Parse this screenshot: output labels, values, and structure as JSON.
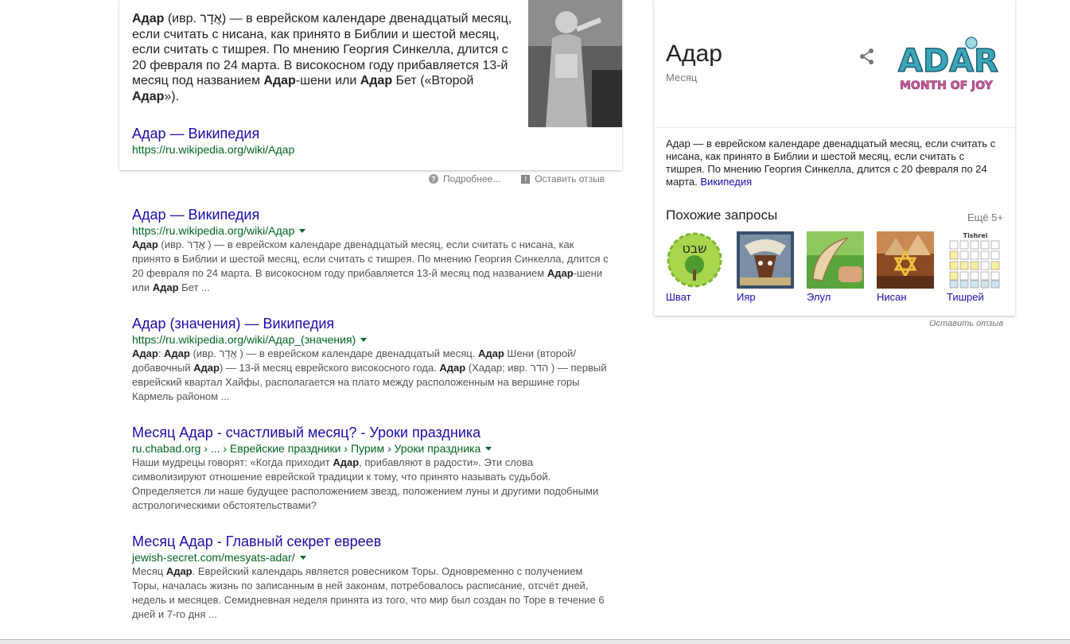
{
  "featured": {
    "p1_b1": "Адар",
    "p1_t1": " (ивр. אֲדָר) — в еврейском календаре двенадцатый месяц, если считать с нисана, как принято в Библии и шестой месяц, если считать с тишрея. По мнению Георгия Синкелла, длится с 20 февраля по 24 марта. В високосном году прибавляется 13-й месяц под названием ",
    "p1_b2": "Адар",
    "p1_t2": "-шени или ",
    "p1_b3": "Адар",
    "p1_t3": " Бет («Второй ",
    "p1_b4": "Адар",
    "p1_t4": "»).",
    "title": "Адар — Википедия",
    "url": "https://ru.wikipedia.org/wiki/Адар",
    "more_label": "Подробнее...",
    "feedback_label": "Оставить отзыв"
  },
  "results": [
    {
      "title": "Адар — Википедия",
      "url": "https://ru.wikipedia.org/wiki/Адар",
      "s": [
        {
          "b": "Адар"
        },
        {
          "t": " (ивр. אֲדָר ) — в еврейском календаре двенадцатый месяц, если считать с нисана, как принято в Библии и шестой месяц, если считать с тишрея. По мнению Георгия Синкелла, длится с 20 февраля по 24 марта. В високосном году прибавляется 13-й месяц под названием "
        },
        {
          "b": "Адар"
        },
        {
          "t": "-шени или "
        },
        {
          "b": "Адар"
        },
        {
          "t": " Бет ..."
        }
      ]
    },
    {
      "title": "Адар (значения) — Википедия",
      "url": "https://ru.wikipedia.org/wiki/Адар_(значения)",
      "s": [
        {
          "b": "Адар"
        },
        {
          "t": ": "
        },
        {
          "b": "Адар"
        },
        {
          "t": " (ивр. אֲדָר ) — в еврейском календаре двенадцатый месяц. "
        },
        {
          "b": "Адар"
        },
        {
          "t": " Шени (второй/ добавочный "
        },
        {
          "b": "Адар"
        },
        {
          "t": ") — 13-й месяц еврейского високосного года. "
        },
        {
          "b": "Адар"
        },
        {
          "t": " (Хадар; ивр. הדר ) — первый еврейский квартал Хайфы, располагается на плато между расположенным на вершине горы Кармель районом ..."
        }
      ]
    },
    {
      "title": "Месяц Адар - счастливый месяц? - Уроки праздника",
      "url": "ru.chabad.org › ... › Еврейские праздники › Пурим › Уроки праздника",
      "s": [
        {
          "t": "Наши мудрецы говорят: «Когда приходит "
        },
        {
          "b": "Адар"
        },
        {
          "t": ", прибавляют в радости». Эти слова символизируют отношение еврейской традиции к тому, что принято называть судьбой. Определяется ли наше будущее расположением звезд, положением луны и другими подобными астрологическими обстоятельствами?"
        }
      ]
    },
    {
      "title": "Месяц Адар - Главный секрет евреев",
      "url": "jewish-secret.com/mesyats-adar/",
      "s": [
        {
          "t": "Месяц "
        },
        {
          "b": "Адар"
        },
        {
          "t": ". Еврейский календарь является ровесником Торы. Одновременно с получением Торы, началась жизнь по записанным в ней законам, потребовалось расписание, отсчёт дней, недель и месяцев. Семидневная неделя принята из того, что мир был создан по Торе в течение 6 дней и 7-го дня ..."
        }
      ]
    }
  ],
  "kp": {
    "title": "Адар",
    "subtitle": "Месяц",
    "logo_top": "ADAR",
    "logo_bottom": "MONTH OF JOY",
    "desc": "Адар — в еврейском календаре двенадцатый месяц, если считать с нисана, как принято в Библии и шестой месяц, если считать с тишрея. По мнению Георгия Синкелла, длится с 20 февраля по 24 марта. ",
    "desc_link": "Википедия",
    "related_label": "Похожие запросы",
    "more_label": "Ещё 5+",
    "related": [
      {
        "label": "Шват",
        "thumb_text": "שבט"
      },
      {
        "label": "Ияр"
      },
      {
        "label": "Элул"
      },
      {
        "label": "Нисан"
      },
      {
        "label": "Тишрей",
        "thumb_text": "Tishrei"
      }
    ],
    "feedback_label": "Оставить отзыв"
  }
}
